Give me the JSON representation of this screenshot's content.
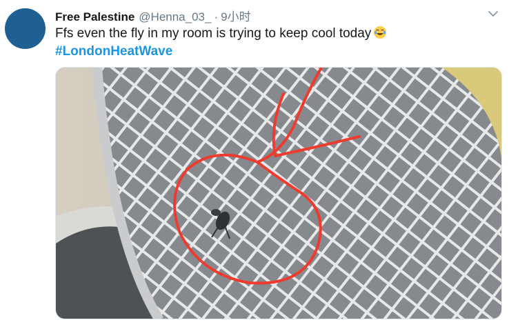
{
  "tweet": {
    "display_name": "Free Palestine",
    "handle": "@Henna_03_",
    "separator": "·",
    "time": "9小时",
    "text": "Ffs even the fly in my room is trying to keep cool today",
    "hashtag": "#LondonHeatWave",
    "emoji": "face-with-tears-of-joy-icon"
  },
  "colors": {
    "avatar": "#1f5f93",
    "hashtag": "#1b95e0",
    "secondary_text": "#657786",
    "annotation_red": "#ee3b2f"
  }
}
